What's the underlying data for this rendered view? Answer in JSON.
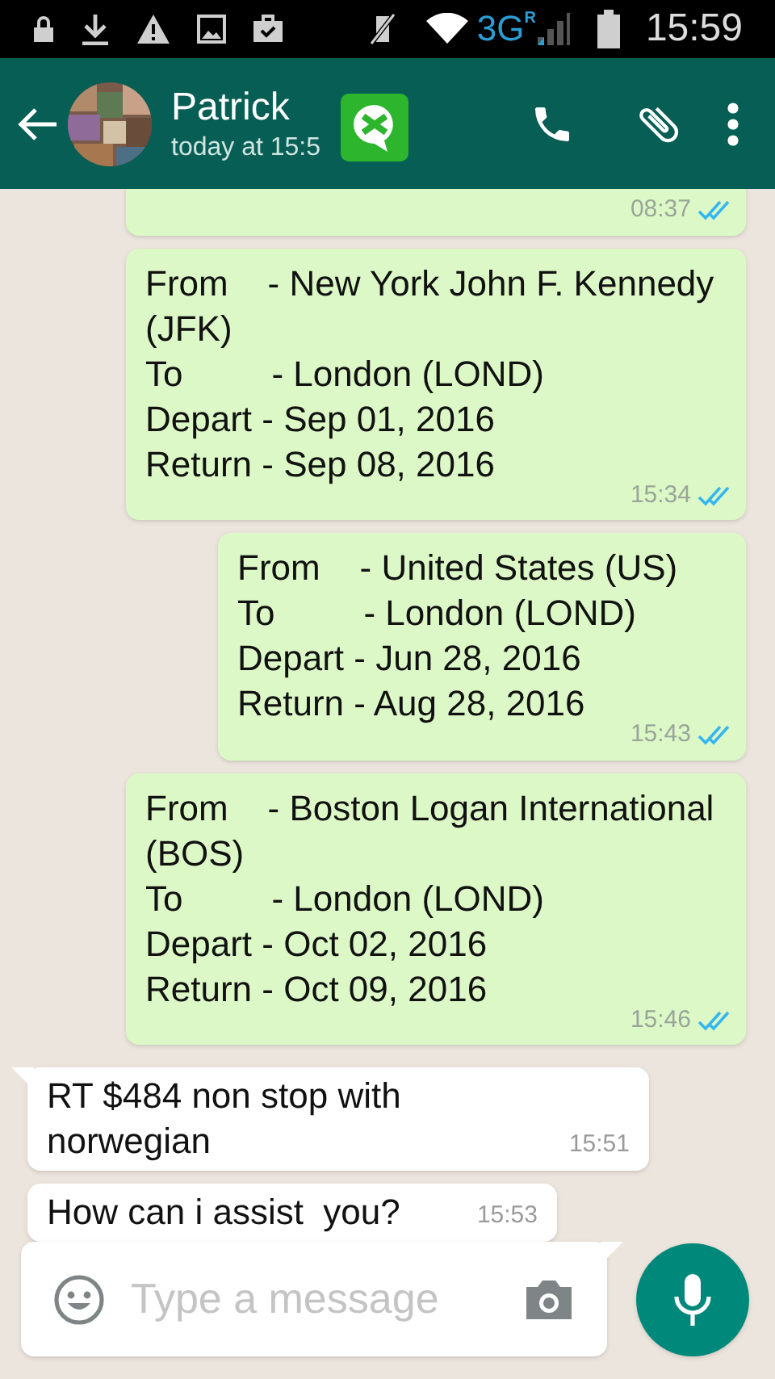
{
  "status_bar": {
    "time": "15:59",
    "network": "3G",
    "roaming": "R"
  },
  "header": {
    "contact_name": "Patrick",
    "last_seen": "today at 15:5"
  },
  "messages": [
    {
      "kind": "cut",
      "time": "08:37",
      "read": true
    },
    {
      "kind": "sent",
      "lines": [
        "From    - New York John F. Kennedy (JFK)",
        "To         - London (LOND)",
        "Depart - Sep 01, 2016",
        "Return - Sep 08, 2016"
      ],
      "time": "15:34",
      "read": true
    },
    {
      "kind": "sent",
      "lines": [
        "From    - United States (US)",
        "To         - London (LOND)",
        "Depart - Jun 28, 2016",
        "Return - Aug 28, 2016"
      ],
      "time": "15:43",
      "read": true
    },
    {
      "kind": "sent",
      "lines": [
        "From    - Boston Logan International (BOS)",
        "To         - London (LOND)",
        "Depart - Oct 02, 2016",
        "Return - Oct 09, 2016"
      ],
      "time": "15:46",
      "read": true
    },
    {
      "kind": "received",
      "tail": true,
      "text": "RT $484 non stop with norwegian",
      "time": "15:51"
    },
    {
      "kind": "received",
      "tail": false,
      "text": "How can i assist  you?",
      "time": "15:53"
    }
  ],
  "composer": {
    "placeholder": "Type a message"
  }
}
